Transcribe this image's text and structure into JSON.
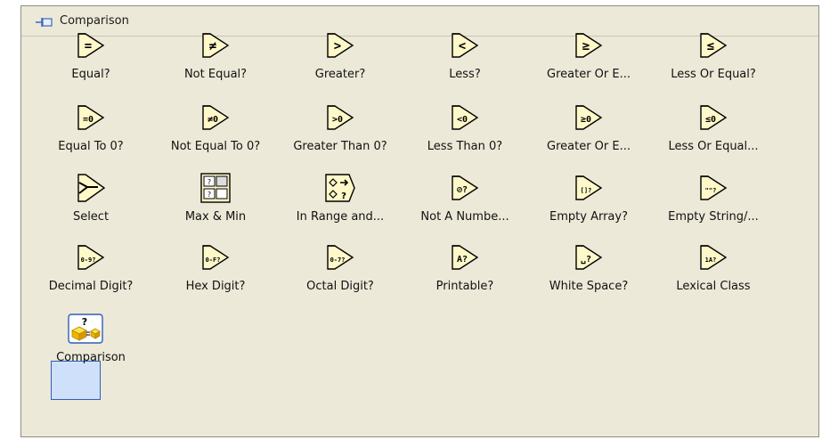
{
  "palette": {
    "title": "Comparison",
    "items": [
      {
        "label": "Equal?",
        "glyph": "="
      },
      {
        "label": "Not Equal?",
        "glyph": "≠"
      },
      {
        "label": "Greater?",
        "glyph": ">"
      },
      {
        "label": "Less?",
        "glyph": "<"
      },
      {
        "label": "Greater Or E...",
        "glyph": "≥"
      },
      {
        "label": "Less Or Equal?",
        "glyph": "≤"
      },
      {
        "label": "Equal To 0?",
        "glyph": "=0"
      },
      {
        "label": "Not Equal To 0?",
        "glyph": "≠0"
      },
      {
        "label": "Greater Than 0?",
        "glyph": ">0"
      },
      {
        "label": "Less Than 0?",
        "glyph": "<0"
      },
      {
        "label": "Greater Or E...",
        "glyph": "≥0"
      },
      {
        "label": "Less Or Equal...",
        "glyph": "≤0"
      },
      {
        "label": "Select",
        "glyph": ""
      },
      {
        "label": "Max & Min",
        "glyph": ""
      },
      {
        "label": "In Range and...",
        "glyph": ""
      },
      {
        "label": "Not A Numbe...",
        "glyph": "⊘?"
      },
      {
        "label": "Empty Array?",
        "glyph": "[]?"
      },
      {
        "label": "Empty String/...",
        "glyph": "\"\"?"
      },
      {
        "label": "Decimal Digit?",
        "glyph": "0-9?"
      },
      {
        "label": "Hex Digit?",
        "glyph": "0-F?"
      },
      {
        "label": "Octal Digit?",
        "glyph": "0-7?"
      },
      {
        "label": "Printable?",
        "glyph": "A?"
      },
      {
        "label": "White Space?",
        "glyph": "␣?"
      },
      {
        "label": "Lexical Class",
        "glyph": "1A?"
      },
      {
        "label": "Comparison",
        "glyph": ""
      }
    ]
  },
  "colors": {
    "panel_bg": "#ece9d8",
    "icon_fill": "#fff8c8",
    "icon_stroke": "#000000",
    "selection": "#cfe0fb"
  }
}
